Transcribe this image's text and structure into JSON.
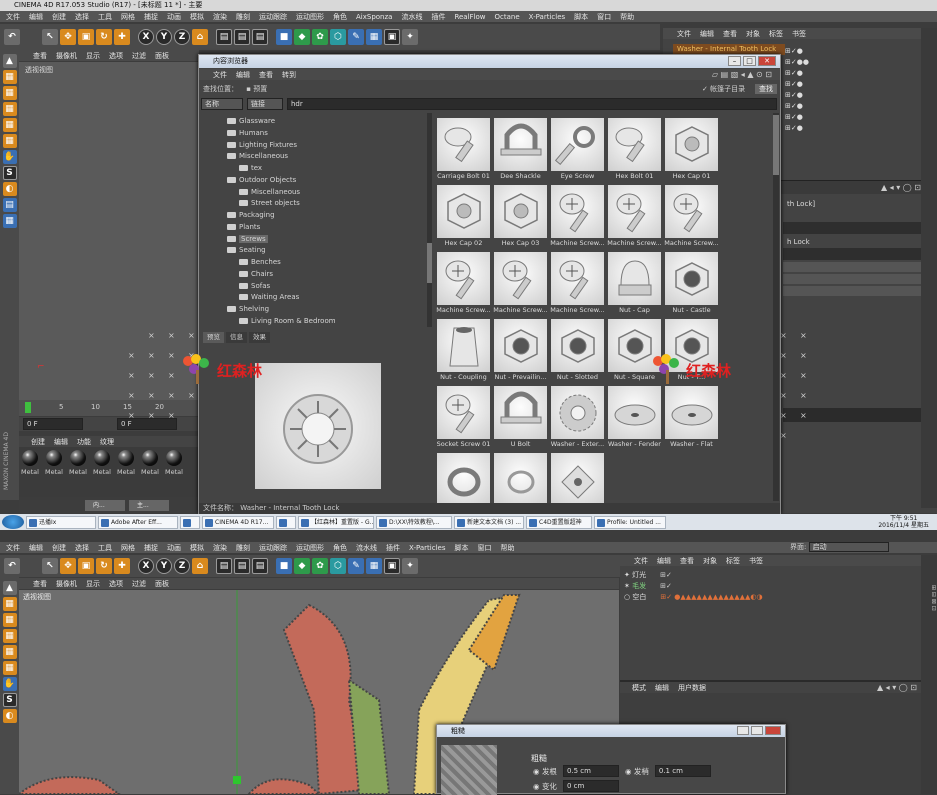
{
  "top": {
    "title": "CINEMA 4D R17.053 Studio (R17) - [未标题 11 *] - 主要",
    "menu": [
      "文件",
      "编辑",
      "创建",
      "选择",
      "工具",
      "网格",
      "捕捉",
      "动画",
      "模拟",
      "渲染",
      "雕刻",
      "运动跟踪",
      "运动图形",
      "角色",
      "AixSponza",
      "流水线",
      "插件",
      "RealFlow",
      "Octane",
      "X-Particles",
      "脚本",
      "窗口",
      "帮助"
    ],
    "view_menu": [
      "查看",
      "摄像机",
      "显示",
      "选项",
      "过滤",
      "面板"
    ],
    "viewport_label": "透视视图",
    "timeline_ticks": [
      "0",
      "5",
      "10",
      "15",
      "20"
    ],
    "frame_field": "0 F",
    "frame_field2": "0 F",
    "material_tabs": [
      "创建",
      "编辑",
      "功能",
      "纹理"
    ],
    "materials": [
      "Metal",
      "Metal",
      "Metal",
      "Metal",
      "Metal",
      "Metal",
      "Metal"
    ],
    "bottom_tasks": [
      "内...",
      "主..."
    ],
    "maxon": "MAXON CINEMA 4D",
    "objects_menu": [
      "文件",
      "编辑",
      "查看",
      "对象",
      "标签",
      "书签"
    ],
    "selected_object": "Washer - Internal Tooth Lock",
    "attr_frag1": "th Lock]",
    "attr_frag2": "h Lock"
  },
  "browser": {
    "title": "内容浏览器",
    "menu": [
      "文件",
      "编辑",
      "查看",
      "转到"
    ],
    "search_label": "查找位置：",
    "preset": "预置",
    "sort_name": "名称",
    "sort_kind": "链接",
    "search_value": "hdr",
    "checkbox_label": "帐篷子目录",
    "search_button": "查找",
    "tree": [
      {
        "label": "Glassware",
        "indent": 2
      },
      {
        "label": "Humans",
        "indent": 2
      },
      {
        "label": "Lighting Fixtures",
        "indent": 2
      },
      {
        "label": "Miscellaneous",
        "indent": 2
      },
      {
        "label": "tex",
        "indent": 3
      },
      {
        "label": "Outdoor Objects",
        "indent": 2
      },
      {
        "label": "Miscellaneous",
        "indent": 3
      },
      {
        "label": "Street objects",
        "indent": 3
      },
      {
        "label": "Packaging",
        "indent": 2
      },
      {
        "label": "Plants",
        "indent": 2
      },
      {
        "label": "Screws",
        "indent": 2,
        "selected": true
      },
      {
        "label": "Seating",
        "indent": 2
      },
      {
        "label": "Benches",
        "indent": 3
      },
      {
        "label": "Chairs",
        "indent": 3
      },
      {
        "label": "Sofas",
        "indent": 3
      },
      {
        "label": "Waiting Areas",
        "indent": 3
      },
      {
        "label": "Shelving",
        "indent": 2
      },
      {
        "label": "Living Room & Bedroom",
        "indent": 3
      }
    ],
    "preview_tabs": [
      "预览",
      "信息",
      "效果"
    ],
    "items": [
      {
        "label": "Carriage Bolt 01",
        "shape": "bolt"
      },
      {
        "label": "Dee Shackle",
        "shape": "shackle"
      },
      {
        "label": "Eye Screw",
        "shape": "eye"
      },
      {
        "label": "Hex Bolt 01",
        "shape": "bolt"
      },
      {
        "label": "Hex Cap 01",
        "shape": "hexcap"
      },
      {
        "label": "Hex Cap 02",
        "shape": "hexcap"
      },
      {
        "label": "Hex Cap 03",
        "shape": "hexcap"
      },
      {
        "label": "Machine Screw...",
        "shape": "screw"
      },
      {
        "label": "Machine Screw...",
        "shape": "screw"
      },
      {
        "label": "Machine Screw...",
        "shape": "screw"
      },
      {
        "label": "Machine Screw...",
        "shape": "screw"
      },
      {
        "label": "Machine Screw...",
        "shape": "screw"
      },
      {
        "label": "Machine Screw...",
        "shape": "screw"
      },
      {
        "label": "Nut - Cap",
        "shape": "capnut"
      },
      {
        "label": "Nut - Castle",
        "shape": "nut"
      },
      {
        "label": "Nut - Coupling",
        "shape": "coupling"
      },
      {
        "label": "Nut - Prevailin...",
        "shape": "nut"
      },
      {
        "label": "Nut - Slotted",
        "shape": "nut"
      },
      {
        "label": "Nut - Square",
        "shape": "nut"
      },
      {
        "label": "Nut - T...",
        "shape": "nut"
      },
      {
        "label": "Socket Screw 01",
        "shape": "screw"
      },
      {
        "label": "U Bolt",
        "shape": "shackle"
      },
      {
        "label": "Washer - Exter...",
        "shape": "washer"
      },
      {
        "label": "Washer - Fender",
        "shape": "flatwasher"
      },
      {
        "label": "Washer - Flat",
        "shape": "flatwasher"
      },
      {
        "label": "",
        "shape": "lockwasher"
      },
      {
        "label": "",
        "shape": "ring"
      },
      {
        "label": "",
        "shape": "square"
      }
    ],
    "status_label": "文件名称：",
    "status_value": "Washer - Internal Tooth Lock"
  },
  "taskbar": {
    "items": [
      "迅播Ix",
      "Adobe After Eff...",
      "",
      "CINEMA 4D R17...",
      "",
      "【红森林】重置版 - G...",
      "D:\\XX\\特效教程\\...",
      "新建文本文档 (3) ...",
      "C4D重置版超神",
      "Profile: Untitled ..."
    ],
    "time": "下午 9:51",
    "date": "2016/11/4 星期五"
  },
  "bottom": {
    "menu": [
      "文件",
      "编辑",
      "创建",
      "选择",
      "工具",
      "网格",
      "捕捉",
      "动画",
      "模拟",
      "渲染",
      "雕刻",
      "运动跟踪",
      "运动图形",
      "角色",
      "流水线",
      "插件",
      "X-Particles",
      "脚本",
      "窗口",
      "帮助"
    ],
    "layout_label": "界面:",
    "layout_value": "启动",
    "view_menu": [
      "查看",
      "摄像机",
      "显示",
      "选项",
      "过滤",
      "面板"
    ],
    "viewport_label": "透视视图",
    "objects_menu": [
      "文件",
      "编辑",
      "查看",
      "对象",
      "标签",
      "书签"
    ],
    "objects": [
      "灯光",
      "毛发",
      "空白"
    ],
    "attr_menu": [
      "模式",
      "编辑",
      "用户数据"
    ],
    "dialog_title": "粗糙",
    "side_label": "粗糙",
    "p1_label": "发根",
    "p1_value": "0.5 cm",
    "p2_label": "发梢",
    "p2_value": "0.1 cm",
    "p3_label": "变化",
    "p3_value": "0 cm"
  },
  "watermark": "红森林"
}
